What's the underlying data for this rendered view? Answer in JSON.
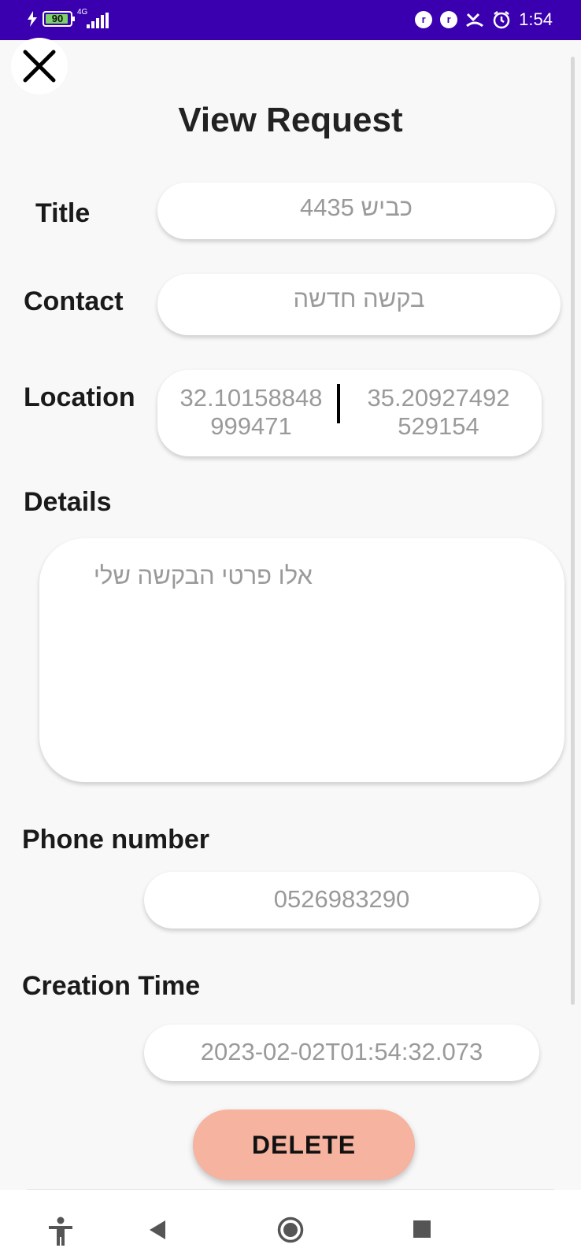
{
  "status_bar": {
    "battery_level": "90",
    "network_type": "4G",
    "time": "1:54"
  },
  "header": {
    "title": "View Request"
  },
  "form": {
    "title_label": "Title",
    "title_value": "כביש 4435",
    "contact_label": "Contact",
    "contact_value": "בקשה חדשה",
    "location_label": "Location",
    "location_left_line1": "32.10158848",
    "location_left_line2": "999471",
    "location_right_line1": "35.20927492",
    "location_right_line2": "529154",
    "details_label": "Details",
    "details_value": "אלו פרטי הבקשה שלי",
    "phone_label": "Phone number",
    "phone_value": "0526983290",
    "creation_label": "Creation Time",
    "creation_value": "2023-02-02T01:54:32.073"
  },
  "actions": {
    "delete_label": "DELETE"
  },
  "icons": {
    "close": "close-icon",
    "accessibility": "accessibility-icon",
    "back": "back-icon",
    "home": "home-icon",
    "recents": "recents-icon"
  },
  "colors": {
    "status_bar": "#3a00b0",
    "delete_button": "#f5b3a0",
    "field_text": "#9a9a9a"
  }
}
